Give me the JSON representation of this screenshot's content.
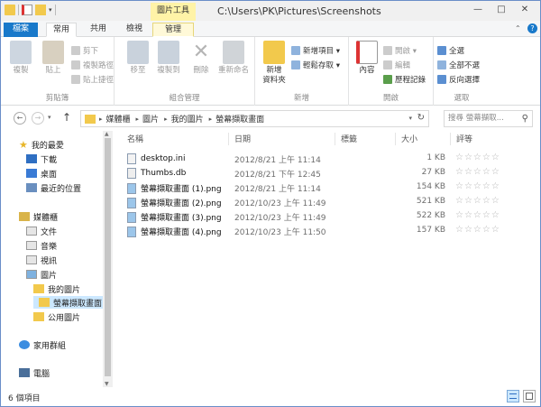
{
  "window": {
    "title": "C:\\Users\\PK\\Pictures\\Screenshots",
    "context_tab_group": "圖片工具",
    "controls": {
      "minimize": "—",
      "maximize": "□",
      "close": "✕"
    }
  },
  "tabs": {
    "file": "檔案",
    "home": "常用",
    "share": "共用",
    "view": "檢視",
    "manage": "管理"
  },
  "ribbon": {
    "clipboard": {
      "label": "剪貼簿",
      "copy": "複製",
      "paste": "貼上",
      "cut": "剪下",
      "copy_path": "複製路徑",
      "paste_shortcut": "貼上捷徑"
    },
    "organize": {
      "label": "組合管理",
      "move_to": "移至",
      "copy_to": "複製到",
      "delete": "刪除",
      "rename": "重新命名"
    },
    "new": {
      "label": "新增",
      "new_folder": "新增\n資料夾",
      "new_item": "新增項目 ▾",
      "easy_access": "輕鬆存取 ▾"
    },
    "open": {
      "label": "開啟",
      "properties": "內容",
      "open": "開啟 ▾",
      "edit": "編輯",
      "history": "歷程記錄"
    },
    "select": {
      "label": "選取",
      "select_all": "全選",
      "select_none": "全部不選",
      "invert": "反向選擇"
    }
  },
  "address": {
    "crumbs": [
      "媒體櫃",
      "圖片",
      "我的圖片",
      "螢幕擷取畫面"
    ],
    "search_placeholder": "搜尋 螢幕擷取..."
  },
  "nav": {
    "favorites": "我的最愛",
    "downloads": "下載",
    "desktop": "桌面",
    "recent": "最近的位置",
    "libraries": "媒體櫃",
    "documents": "文件",
    "music": "音樂",
    "videos": "視訊",
    "pictures": "圖片",
    "my_pictures": "我的圖片",
    "screenshots": "螢幕擷取畫面",
    "public_pictures": "公用圖片",
    "homegroup": "家用群組",
    "computer": "電腦"
  },
  "columns": {
    "name": "名稱",
    "date": "日期",
    "tags": "標籤",
    "size": "大小",
    "rating": "評等"
  },
  "files": [
    {
      "name": "desktop.ini",
      "date": "2012/8/21 上午 11:14",
      "size": "1 KB",
      "rating": "☆☆☆☆☆",
      "icon": "settings-file-icon"
    },
    {
      "name": "Thumbs.db",
      "date": "2012/8/21 下午 12:45",
      "size": "27 KB",
      "rating": "☆☆☆☆☆",
      "icon": "db-file-icon"
    },
    {
      "name": "螢幕擷取畫面 (1).png",
      "date": "2012/8/21 上午 11:14",
      "size": "154 KB",
      "rating": "☆☆☆☆☆",
      "icon": "image-file-icon"
    },
    {
      "name": "螢幕擷取畫面 (2).png",
      "date": "2012/10/23 上午 11:49",
      "size": "521 KB",
      "rating": "☆☆☆☆☆",
      "icon": "image-file-icon"
    },
    {
      "name": "螢幕擷取畫面 (3).png",
      "date": "2012/10/23 上午 11:49",
      "size": "522 KB",
      "rating": "☆☆☆☆☆",
      "icon": "image-file-icon"
    },
    {
      "name": "螢幕擷取畫面 (4).png",
      "date": "2012/10/23 上午 11:50",
      "size": "157 KB",
      "rating": "☆☆☆☆☆",
      "icon": "image-file-icon"
    }
  ],
  "status": {
    "item_count": "6 個項目"
  },
  "colors": {
    "file_tab": "#1979ca",
    "context_tab": "#fff3a7",
    "selection": "#cce8ff"
  }
}
